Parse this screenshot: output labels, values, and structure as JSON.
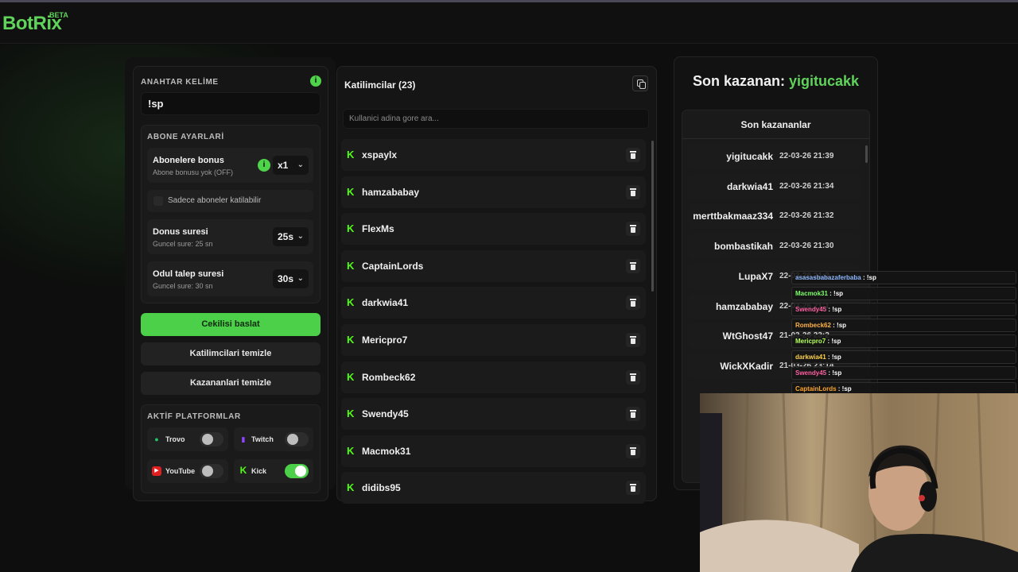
{
  "app": {
    "logo": "BotRix",
    "beta": "BETA"
  },
  "keyword": {
    "label": "ANAHTAR KELİME",
    "value": "!sp"
  },
  "subscriber_settings": {
    "label": "ABONE AYARLARİ",
    "bonus": {
      "title": "Abonelere bonus",
      "subtitle": "Abone bonusu yok (OFF)",
      "select_value": "x1"
    },
    "only_subs": {
      "label": "Sadece aboneler katilabilir"
    },
    "bonus_duration": {
      "title": "Donus suresi",
      "subtitle": "Guncel sure: 25 sn",
      "select_value": "25s"
    },
    "claim_duration": {
      "title": "Odul talep suresi",
      "subtitle": "Guncel sure: 30 sn",
      "select_value": "30s"
    }
  },
  "actions": {
    "start": "Cekilisi baslat",
    "clear_participants": "Katilimcilari temizle",
    "clear_winners": "Kazananlari temizle"
  },
  "platforms": {
    "label": "AKTİF PLATFORMLAR",
    "items": [
      {
        "name": "Trovo",
        "enabled": false,
        "color": "#1ec86a"
      },
      {
        "name": "Twitch",
        "enabled": false,
        "color": "#9146ff"
      },
      {
        "name": "YouTube",
        "enabled": false,
        "color": "#ff0000"
      },
      {
        "name": "Kick",
        "enabled": true,
        "color": "#53fc18"
      }
    ]
  },
  "participants": {
    "title": "Katilimcilar (23)",
    "search_placeholder": "Kullanici adina gore ara...",
    "items": [
      "xspaylx",
      "hamzababay",
      "FlexMs",
      "CaptainLords",
      "darkwia41",
      "Mericpro7",
      "Rombeck62",
      "Swendy45",
      "Macmok31",
      "didibs95"
    ]
  },
  "winner": {
    "prefix": "Son kazanan:",
    "name": "yigitucakk",
    "list_title": "Son kazananlar",
    "items": [
      {
        "name": "yigitucakk",
        "date": "22-03-26 21:39"
      },
      {
        "name": "darkwia41",
        "date": "22-03-26 21:34"
      },
      {
        "name": "merttbakmaaz334",
        "date": "22-03-26 21:32"
      },
      {
        "name": "bombastikah",
        "date": "22-03-26 21:30"
      },
      {
        "name": "LupaX7",
        "date": "22-03-26 21:2"
      },
      {
        "name": "hamzababay",
        "date": "22-03-26 21:1"
      },
      {
        "name": "WtGhost47",
        "date": "21-03-26 23:2"
      },
      {
        "name": "WickXKadir",
        "date": "21-03-26 23:14"
      }
    ]
  },
  "chat": [
    {
      "user": "asasasbabazaferbaba",
      "msg": "!sp",
      "color": "#8fb8ff"
    },
    {
      "user": "Macmok31",
      "msg": "!sp",
      "color": "#7cff6b"
    },
    {
      "user": "Swendy45",
      "msg": "!sp",
      "color": "#ff5fa2"
    },
    {
      "user": "Rombeck62",
      "msg": "!sp",
      "color": "#ffb347"
    },
    {
      "user": "Mericpro7",
      "msg": "!sp",
      "color": "#b4ff5a"
    },
    {
      "user": "darkwia41",
      "msg": "!sp",
      "color": "#ffd24a"
    },
    {
      "user": "Swendy45",
      "msg": "!sp",
      "color": "#ff5fa2"
    },
    {
      "user": "CaptainLords",
      "msg": "!sp",
      "color": "#ffa62b"
    }
  ]
}
